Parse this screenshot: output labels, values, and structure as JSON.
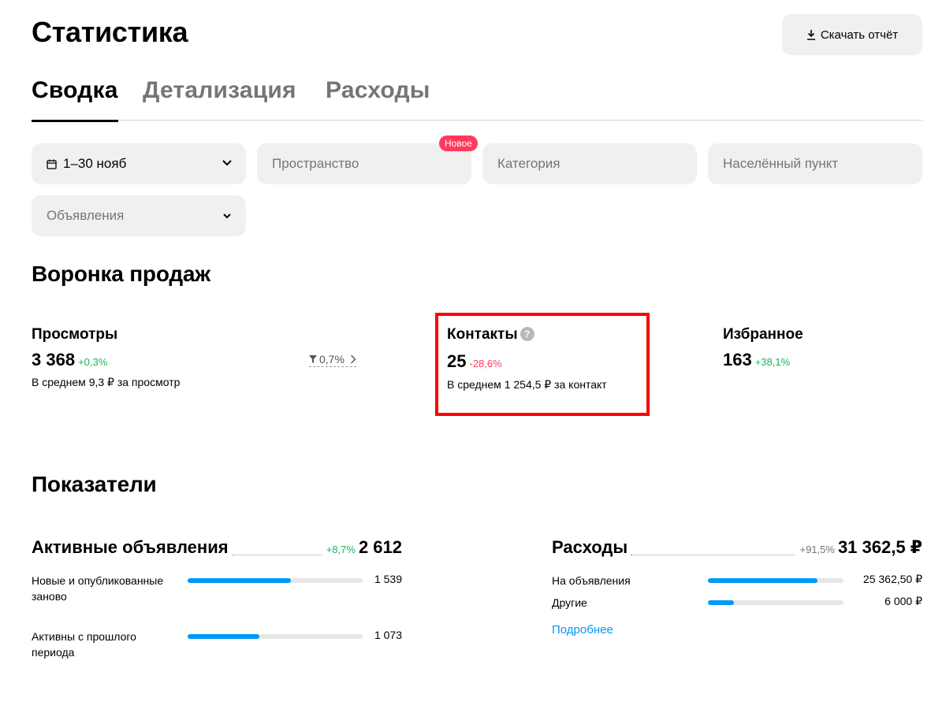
{
  "header": {
    "title": "Статистика",
    "download_label": "Скачать отчёт"
  },
  "tabs": [
    {
      "label": "Сводка",
      "active": true
    },
    {
      "label": "Детализация",
      "active": false
    },
    {
      "label": "Расходы",
      "active": false
    }
  ],
  "filters": {
    "period": "1–30 нояб",
    "space_placeholder": "Пространство",
    "space_badge": "Новое",
    "category_placeholder": "Категория",
    "location_placeholder": "Населённый пункт",
    "ads_placeholder": "Объявления"
  },
  "funnel": {
    "title": "Воронка продаж",
    "views": {
      "label": "Просмотры",
      "value": "3 368",
      "delta": "+0,3%",
      "sub": "В среднем 9,3 ₽ за просмотр"
    },
    "conversion": "0,7%",
    "contacts": {
      "label": "Контакты",
      "help": "?",
      "value": "25",
      "delta": "-28,6%",
      "sub": "В среднем 1 254,5 ₽ за контакт"
    },
    "favorites": {
      "label": "Избранное",
      "value": "163",
      "delta": "+38,1%"
    }
  },
  "indicators": {
    "title": "Показатели",
    "active_ads": {
      "title": "Активные объявления",
      "delta": "+8,7%",
      "value": "2 612",
      "rows": [
        {
          "label": "Новые и опубликованные заново",
          "value": "1 539",
          "share": 0.59
        },
        {
          "label": "Активны с прошлого периода",
          "value": "1 073",
          "share": 0.41
        }
      ]
    },
    "expenses": {
      "title": "Расходы",
      "delta": "+91,5%",
      "value": "31 362,5 ₽",
      "rows": [
        {
          "label": "На объявления",
          "value": "25 362,50 ₽",
          "share": 0.81
        },
        {
          "label": "Другие",
          "value": "6 000 ₽",
          "share": 0.19
        }
      ],
      "more_link": "Подробнее"
    }
  },
  "colors": {
    "accent": "#0099f7",
    "positive": "#1db25a",
    "negative": "#ff3b5c",
    "highlight": "#ff0000"
  }
}
